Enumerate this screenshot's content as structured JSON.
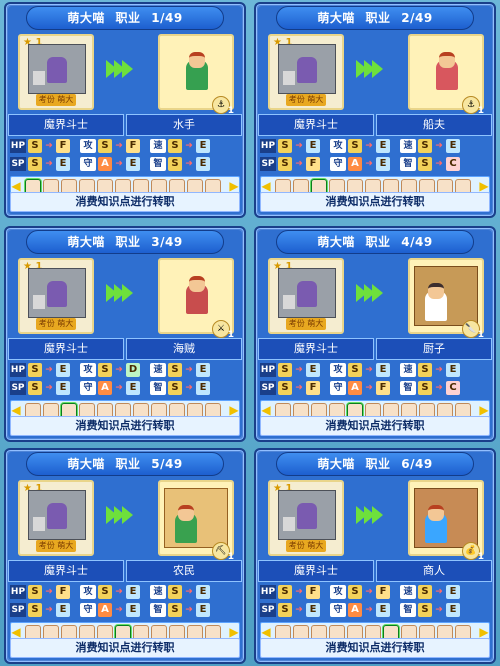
{
  "title_name": "萌大喵",
  "title_prefix": "职业",
  "panels": [
    {
      "title_index": "1/49",
      "left_job": "魔界斗士",
      "right_job": "水手",
      "stats": [
        [
          "HP",
          "S",
          "F",
          "攻",
          "S",
          "F",
          "速",
          "S",
          "E"
        ],
        [
          "SP",
          "S",
          "E",
          "守",
          "A",
          "E",
          "智",
          "S",
          "E"
        ]
      ],
      "tool_count": "1",
      "star_level": "1",
      "badge": "考份 萌大"
    },
    {
      "title_index": "2/49",
      "left_job": "魔界斗士",
      "right_job": "船夫",
      "stats": [
        [
          "HP",
          "S",
          "E",
          "攻",
          "S",
          "E",
          "速",
          "S",
          "E"
        ],
        [
          "SP",
          "S",
          "F",
          "守",
          "A",
          "E",
          "智",
          "S",
          "C"
        ]
      ],
      "tool_count": "1",
      "star_level": "1",
      "badge": "考份 萌大"
    },
    {
      "title_index": "3/49",
      "left_job": "魔界斗士",
      "right_job": "海贼",
      "stats": [
        [
          "HP",
          "S",
          "E",
          "攻",
          "S",
          "D",
          "速",
          "S",
          "E"
        ],
        [
          "SP",
          "S",
          "E",
          "守",
          "A",
          "E",
          "智",
          "S",
          "E"
        ]
      ],
      "tool_count": "1",
      "star_level": "1",
      "badge": "考份 萌大"
    },
    {
      "title_index": "4/49",
      "left_job": "魔界斗士",
      "right_job": "厨子",
      "stats": [
        [
          "HP",
          "S",
          "E",
          "攻",
          "S",
          "E",
          "速",
          "S",
          "E"
        ],
        [
          "SP",
          "S",
          "F",
          "守",
          "A",
          "F",
          "智",
          "S",
          "C"
        ]
      ],
      "tool_count": "1",
      "star_level": "1",
      "badge": "考份 萌大"
    },
    {
      "title_index": "5/49",
      "left_job": "魔界斗士",
      "right_job": "农民",
      "stats": [
        [
          "HP",
          "S",
          "F",
          "攻",
          "S",
          "E",
          "速",
          "S",
          "E"
        ],
        [
          "SP",
          "S",
          "E",
          "守",
          "A",
          "E",
          "智",
          "S",
          "E"
        ]
      ],
      "tool_count": "1",
      "star_level": "1",
      "badge": "考份 萌大"
    },
    {
      "title_index": "6/49",
      "left_job": "魔界斗士",
      "right_job": "商人",
      "stats": [
        [
          "HP",
          "S",
          "F",
          "攻",
          "S",
          "F",
          "速",
          "S",
          "E"
        ],
        [
          "SP",
          "S",
          "E",
          "守",
          "A",
          "E",
          "智",
          "S",
          "E"
        ]
      ],
      "tool_count": "1",
      "star_level": "1",
      "badge": "考份 萌大"
    }
  ],
  "footer_text": "消费知识点进行转职",
  "nav_left": "◀",
  "nav_right": "▶",
  "arrow_glyph": "➜"
}
